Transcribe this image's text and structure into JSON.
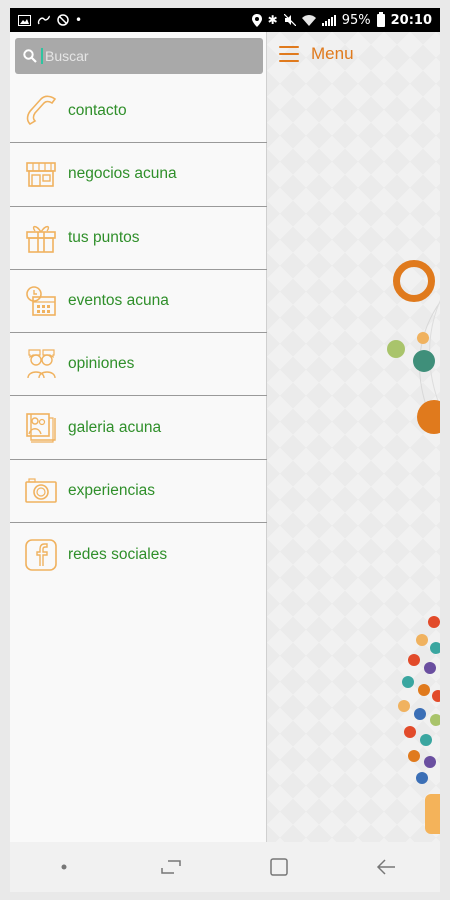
{
  "status_bar": {
    "battery": "95%",
    "time": "20:10"
  },
  "search": {
    "placeholder": "Buscar"
  },
  "header": {
    "menu_label": "Menu"
  },
  "drawer": {
    "items": [
      {
        "label": "contacto",
        "icon": "phone-icon"
      },
      {
        "label": "negocios acuna",
        "icon": "store-icon"
      },
      {
        "label": "tus puntos",
        "icon": "gift-icon"
      },
      {
        "label": "eventos acuna",
        "icon": "calendar-clock-icon"
      },
      {
        "label": "opiniones",
        "icon": "people-chat-icon"
      },
      {
        "label": "galeria acuna",
        "icon": "gallery-icon"
      },
      {
        "label": "experiencias",
        "icon": "camera-icon"
      },
      {
        "label": "redes sociales",
        "icon": "facebook-icon"
      }
    ]
  },
  "colors": {
    "accent": "#e07a1d",
    "label_green": "#2f8f2a",
    "icon_orange": "#f0b25f"
  }
}
